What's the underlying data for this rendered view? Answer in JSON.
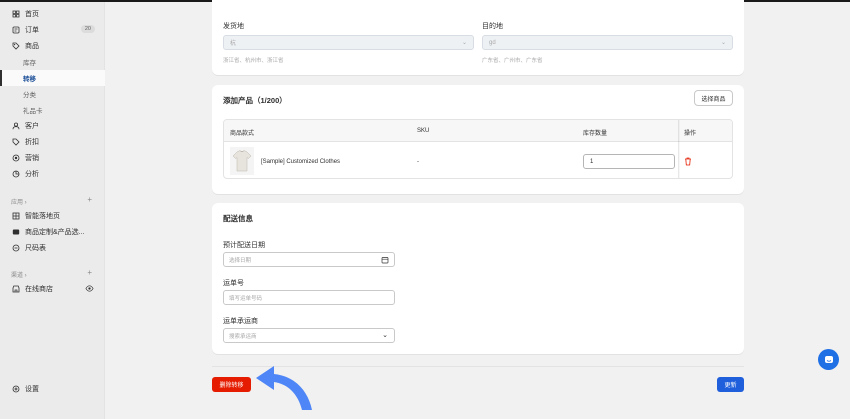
{
  "sidebar": {
    "items": [
      {
        "label": "首页",
        "icon": "home-icon"
      },
      {
        "label": "订单",
        "icon": "order-icon",
        "badge": "20"
      },
      {
        "label": "商品",
        "icon": "tag-icon"
      }
    ],
    "product_subitems": [
      {
        "label": "库存"
      },
      {
        "label": "转移",
        "active": true
      },
      {
        "label": "分类"
      },
      {
        "label": "礼品卡"
      }
    ],
    "items2": [
      {
        "label": "客户",
        "icon": "person-icon"
      },
      {
        "label": "折扣",
        "icon": "discount-icon"
      },
      {
        "label": "营销",
        "icon": "marketing-icon"
      },
      {
        "label": "分析",
        "icon": "analytics-icon"
      }
    ],
    "apps_label": "应用 ›",
    "apps": [
      {
        "label": "智能落地页",
        "icon": "grid-icon"
      },
      {
        "label": "商品定制&产品选...",
        "icon": "app-icon"
      },
      {
        "label": "尺码表",
        "icon": "ruler-icon"
      }
    ],
    "channels_label": "渠道 ›",
    "channels": [
      {
        "label": "在线商店",
        "icon": "store-icon"
      }
    ],
    "settings_label": "设置"
  },
  "locations": {
    "origin_label": "发货地",
    "origin_value": "杭",
    "origin_hint": "浙江省、杭州市、浙江省",
    "destination_label": "目的地",
    "destination_value": "gd",
    "destination_hint": "广东省、广州市、广东省"
  },
  "products": {
    "title": "添加产品（1/200）",
    "select_button": "选择商品",
    "columns": [
      "商品款式",
      "SKU",
      "库存数量",
      "操作"
    ],
    "rows": [
      {
        "name": "[Sample] Customized Clothes",
        "sku": "-",
        "qty": "1"
      }
    ]
  },
  "shipping": {
    "title": "配送信息",
    "date_label": "预计配送日期",
    "date_placeholder": "选择日期",
    "tracking_label": "运单号",
    "tracking_placeholder": "填写运单号码",
    "carrier_label": "运单承运商",
    "carrier_placeholder": "搜索承运商"
  },
  "footer": {
    "delete_label": "删除转移",
    "update_label": "更新"
  },
  "colors": {
    "danger": "#e51c00",
    "primary": "#1f5fdc",
    "accent_arrow": "#4f86f7"
  }
}
